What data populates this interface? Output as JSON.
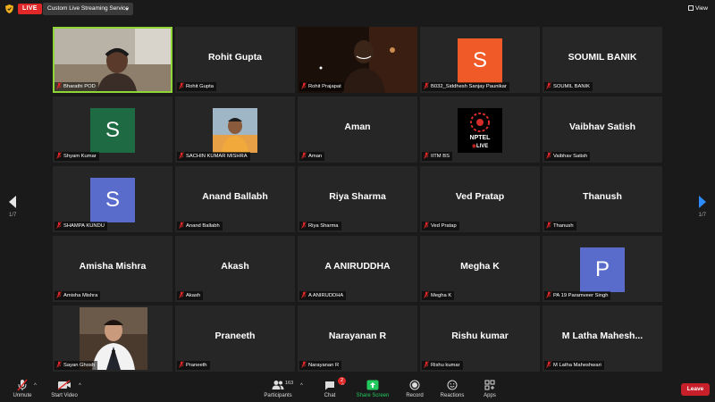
{
  "topbar": {
    "live_label": "LIVE",
    "stream_service": "Custom Live Streaming Service",
    "view_label": "View"
  },
  "pagination": {
    "left": "1/7",
    "right": "1/7"
  },
  "tiles": [
    {
      "display": "",
      "label": "Bharathi POD",
      "kind": "video"
    },
    {
      "display": "Rohit Gupta",
      "label": "Rohit Gupta",
      "kind": "name"
    },
    {
      "display": "",
      "label": "Rohit Prajapat",
      "kind": "video"
    },
    {
      "display": "S",
      "label": "B032_Siddhesh Sanjay Paunikar",
      "kind": "avatar",
      "color": "#f05a28"
    },
    {
      "display": "SOUMIL BANIK",
      "label": "SOUMIL BANIK",
      "kind": "name"
    },
    {
      "display": "S",
      "label": "Shyam Kumar",
      "kind": "avatar",
      "color": "#1e6b43"
    },
    {
      "display": "",
      "label": "SACHIN KUMAR MISHRA",
      "kind": "photo"
    },
    {
      "display": "Aman",
      "label": "Aman",
      "kind": "name"
    },
    {
      "display": "NPTEL",
      "label": "IITM BS",
      "kind": "logo",
      "logo_sub": "LIVE"
    },
    {
      "display": "Vaibhav Satish",
      "label": "Vaibhav Satish",
      "kind": "name"
    },
    {
      "display": "S",
      "label": "SHAMPA KUNDU",
      "kind": "avatar",
      "color": "#5a6ccb"
    },
    {
      "display": "Anand Ballabh",
      "label": "Anand Ballabh",
      "kind": "name"
    },
    {
      "display": "Riya Sharma",
      "label": "Riya Sharma",
      "kind": "name"
    },
    {
      "display": "Ved Pratap",
      "label": "Ved Pratap",
      "kind": "name"
    },
    {
      "display": "Thanush",
      "label": "Thanush",
      "kind": "name"
    },
    {
      "display": "Amisha Mishra",
      "label": "Amisha Mishra",
      "kind": "name"
    },
    {
      "display": "Akash",
      "label": "Akash",
      "kind": "name"
    },
    {
      "display": "A ANIRUDDHA",
      "label": "A ANIRUDDHA",
      "kind": "name"
    },
    {
      "display": "Megha K",
      "label": "Megha K",
      "kind": "name"
    },
    {
      "display": "P",
      "label": "PA 19 Paramveer Singh",
      "kind": "avatar",
      "color": "#5a6ccb"
    },
    {
      "display": "",
      "label": "Sayan Ghosh",
      "kind": "photo"
    },
    {
      "display": "Praneeth",
      "label": "Praneeth",
      "kind": "name"
    },
    {
      "display": "Narayanan R",
      "label": "Narayanan R",
      "kind": "name"
    },
    {
      "display": "Rishu kumar",
      "label": "Rishu kumar",
      "kind": "name"
    },
    {
      "display": "M Latha Mahesh...",
      "label": "M Latha Maheshwari",
      "kind": "name"
    }
  ],
  "toolbar": {
    "unmute": "Unmute",
    "start_video": "Start Video",
    "participants": "Participants",
    "participants_count": "163",
    "chat": "Chat",
    "chat_badge": "2",
    "share_screen": "Share Screen",
    "record": "Record",
    "reactions": "Reactions",
    "apps": "Apps",
    "leave": "Leave"
  },
  "colors": {
    "background": "#1a1a1a",
    "tile": "#262626",
    "active_border": "#8ed636",
    "live_red": "#e02828",
    "share_green": "#23c95e",
    "leave_red": "#c8202a"
  }
}
